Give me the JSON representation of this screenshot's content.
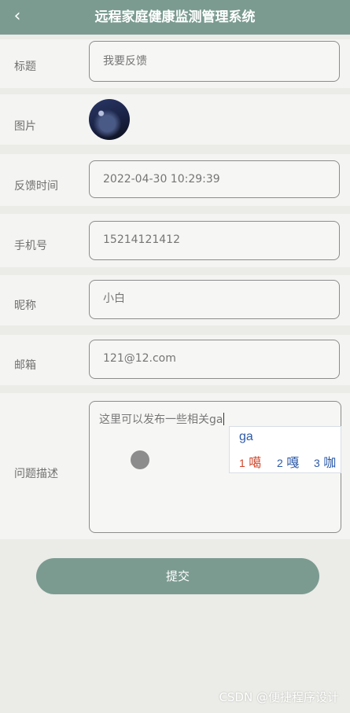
{
  "header": {
    "title": "远程家庭健康监测管理系统",
    "back_icon": "chevron-left-icon"
  },
  "form": {
    "title": {
      "label": "标题",
      "placeholder": "我要反馈"
    },
    "image": {
      "label": "图片"
    },
    "feedback_time": {
      "label": "反馈时间",
      "value": "2022-04-30 10:29:39"
    },
    "phone": {
      "label": "手机号",
      "value": "15214121412"
    },
    "nickname": {
      "label": "昵称",
      "value": "小白"
    },
    "email": {
      "label": "邮箱",
      "value": "121@12.com"
    },
    "description": {
      "label": "问题描述",
      "value": "这里可以发布一些相关ga"
    }
  },
  "ime": {
    "input": "ga",
    "candidates": [
      {
        "index": "1",
        "text": "噶",
        "color": "#d0452a"
      },
      {
        "index": "2",
        "text": "嘎",
        "color": "#2d5aa8"
      },
      {
        "index": "3",
        "text": "咖",
        "color": "#2d5aa8"
      }
    ]
  },
  "submit_label": "提交",
  "watermark": "CSDN @便捷程序设计",
  "colors": {
    "accent": "#7b9b91"
  }
}
